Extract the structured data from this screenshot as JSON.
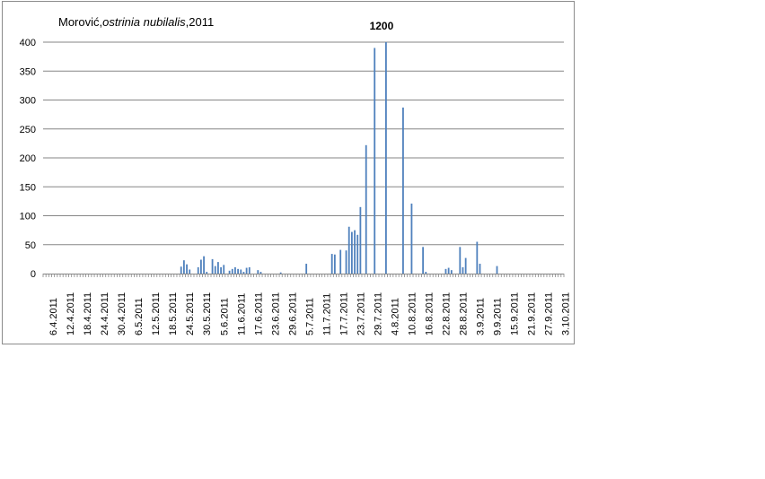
{
  "chart_data": {
    "type": "bar",
    "title_plain": "Morović,",
    "title_italic": "ostrinia nubilalis",
    "title_suffix": ",2011",
    "annotation": "1200",
    "annotation_date": "2011-08-07",
    "ylim": [
      0,
      400
    ],
    "yticks": [
      0,
      50,
      100,
      150,
      200,
      250,
      300,
      350,
      400
    ],
    "grid": "horizontal",
    "x_start": "2011-04-03",
    "x_end": "2011-10-03",
    "xtick_labels": [
      "6.4.2011",
      "12.4.2011",
      "18.4.2011",
      "24.4.2011",
      "30.4.2011",
      "6.5.2011",
      "12.5.2011",
      "18.5.2011",
      "24.5.2011",
      "30.5.2011",
      "5.6.2011",
      "11.6.2011",
      "17.6.2011",
      "23.6.2011",
      "29.6.2011",
      "5.7.2011",
      "11.7.2011",
      "17.7.2011",
      "23.7.2011",
      "29.7.2011",
      "4.8.2011",
      "10.8.2011",
      "16.8.2011",
      "22.8.2011",
      "28.8.2011",
      "3.9.2011",
      "9.9.2011",
      "15.9.2011",
      "21.9.2011",
      "27.9.2011",
      "3.10.2011"
    ],
    "xtick_dates": [
      "2011-04-06",
      "2011-04-12",
      "2011-04-18",
      "2011-04-24",
      "2011-04-30",
      "2011-05-06",
      "2011-05-12",
      "2011-05-18",
      "2011-05-24",
      "2011-05-30",
      "2011-06-05",
      "2011-06-11",
      "2011-06-17",
      "2011-06-23",
      "2011-06-29",
      "2011-07-05",
      "2011-07-11",
      "2011-07-17",
      "2011-07-23",
      "2011-07-29",
      "2011-08-04",
      "2011-08-10",
      "2011-08-16",
      "2011-08-22",
      "2011-08-28",
      "2011-09-03",
      "2011-09-09",
      "2011-09-15",
      "2011-09-21",
      "2011-09-27",
      "2011-10-03"
    ],
    "bar_color": "#4f81bd",
    "series": [
      {
        "x": [
          "2011-05-21",
          "2011-05-22",
          "2011-05-23",
          "2011-05-24",
          "2011-05-27",
          "2011-05-28",
          "2011-05-29",
          "2011-05-30",
          "2011-06-01",
          "2011-06-02",
          "2011-06-03",
          "2011-06-04",
          "2011-06-05",
          "2011-06-07",
          "2011-06-08",
          "2011-06-09",
          "2011-06-10",
          "2011-06-11",
          "2011-06-12",
          "2011-06-13",
          "2011-06-14",
          "2011-06-17",
          "2011-06-18",
          "2011-06-25",
          "2011-07-04",
          "2011-07-13",
          "2011-07-14",
          "2011-07-16",
          "2011-07-18",
          "2011-07-19",
          "2011-07-20",
          "2011-07-21",
          "2011-07-22",
          "2011-07-23",
          "2011-07-25",
          "2011-07-28",
          "2011-08-01",
          "2011-08-07",
          "2011-08-10",
          "2011-08-14",
          "2011-08-15",
          "2011-08-22",
          "2011-08-23",
          "2011-08-24",
          "2011-08-27",
          "2011-08-28",
          "2011-08-29",
          "2011-09-02",
          "2011-09-03",
          "2011-09-09"
        ],
        "values": [
          12,
          23,
          16,
          7,
          11,
          24,
          30,
          3,
          25,
          13,
          20,
          11,
          15,
          5,
          8,
          11,
          8,
          7,
          3,
          10,
          11,
          6,
          3,
          2,
          17,
          34,
          33,
          41,
          40,
          81,
          72,
          75,
          67,
          115,
          222,
          390,
          1200,
          287,
          121,
          46,
          3,
          8,
          10,
          6,
          46,
          11,
          27,
          55,
          17,
          13
        ]
      }
    ]
  }
}
